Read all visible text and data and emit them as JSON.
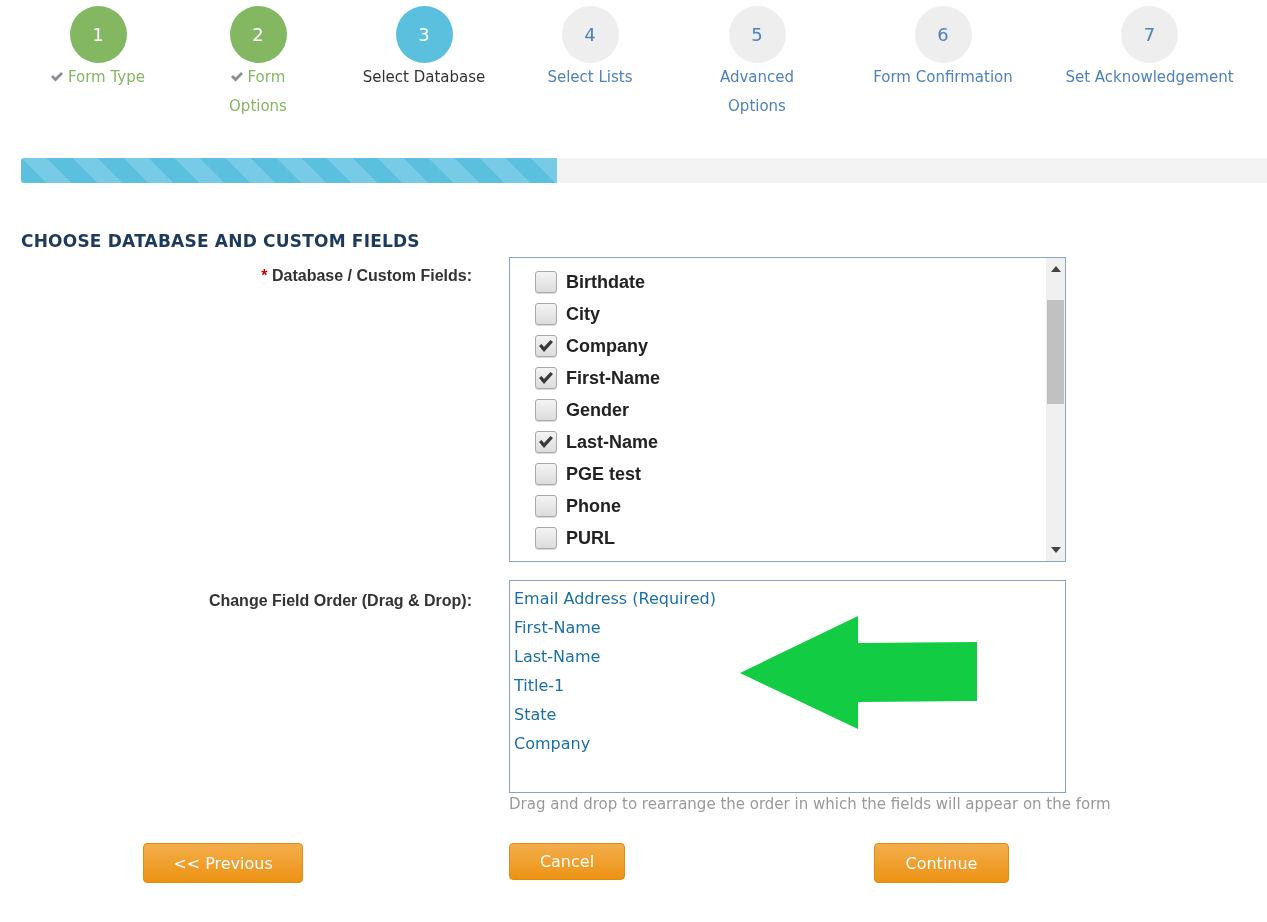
{
  "steps": [
    {
      "number": "1",
      "label": "Form Type",
      "done": true,
      "selected": false
    },
    {
      "number": "2",
      "label": "Form Options",
      "done": true,
      "selected": false
    },
    {
      "number": "3",
      "label": "Select Database",
      "done": false,
      "selected": true
    },
    {
      "number": "4",
      "label": "Select Lists",
      "done": false,
      "selected": false
    },
    {
      "number": "5",
      "label": "Advanced Options",
      "done": false,
      "selected": false
    },
    {
      "number": "6",
      "label": "Form Confirmation",
      "done": false,
      "selected": false
    },
    {
      "number": "7",
      "label": "Set Acknowledgement",
      "done": false,
      "selected": false
    }
  ],
  "progress": {
    "level": 0.43
  },
  "section": {
    "title": "CHOOSE DATABASE AND CUSTOM FIELDS",
    "fields_label": {
      "required_mark": "*",
      "text": "Database / Custom Fields:"
    },
    "fields": [
      {
        "label": "Birthdate",
        "checked": false
      },
      {
        "label": "City",
        "checked": false
      },
      {
        "label": "Company",
        "checked": true
      },
      {
        "label": "First-Name",
        "checked": true
      },
      {
        "label": "Gender",
        "checked": false
      },
      {
        "label": "Last-Name",
        "checked": true
      },
      {
        "label": "PGE test",
        "checked": false
      },
      {
        "label": "Phone",
        "checked": false
      },
      {
        "label": "PURL",
        "checked": false
      }
    ],
    "order_label": "Change Field Order (Drag & Drop):",
    "order": [
      "Email Address (Required)",
      "First-Name",
      "Last-Name",
      "Title-1",
      "State",
      "Company"
    ],
    "order_hint": "Drag and drop to rearrange the order in which the fields will appear on the form"
  },
  "buttons": [
    {
      "label": "<< Previous",
      "kind": "previous"
    },
    {
      "label": "Cancel",
      "kind": "cancel"
    },
    {
      "label": "Continue",
      "kind": "continue"
    }
  ]
}
